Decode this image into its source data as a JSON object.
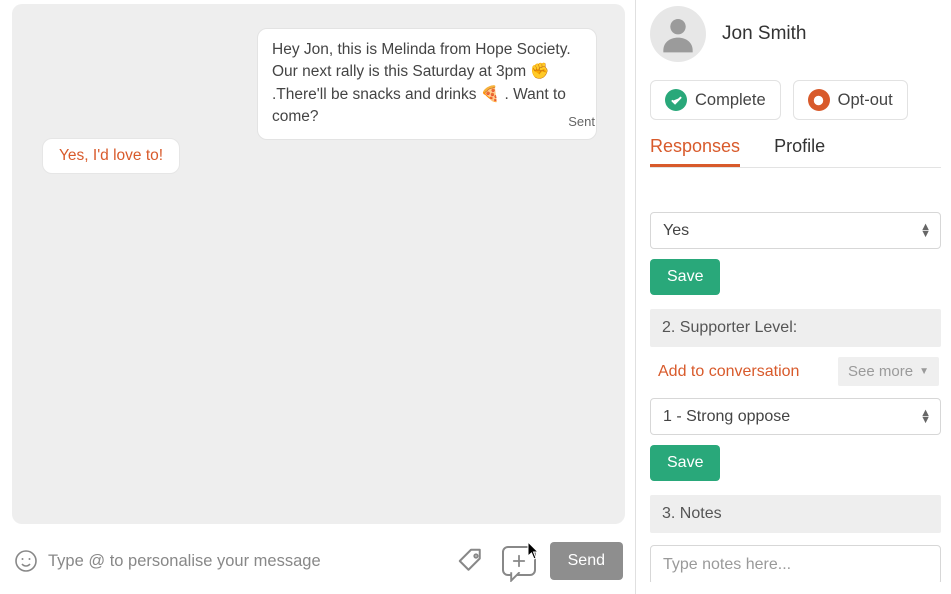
{
  "chat": {
    "outgoing": "Hey Jon, this is Melinda from Hope Society. Our next rally is this Saturday at 3pm ✊ .There'll be snacks and drinks 🍕 . Want to come?",
    "outgoing_status": "Sent",
    "incoming": "Yes, I'd love to!"
  },
  "composer": {
    "placeholder": "Type @ to personalise your message",
    "send_label": "Send"
  },
  "contact": {
    "name": "Jon  Smith"
  },
  "actions": {
    "complete": "Complete",
    "optout": "Opt-out"
  },
  "tabs": {
    "responses": "Responses",
    "profile": "Profile"
  },
  "questions": {
    "q1": {
      "selected": "Yes",
      "save": "Save"
    },
    "q2": {
      "header": "2. Supporter Level:",
      "add_link": "Add to conversation",
      "see_more": "See more",
      "selected": "1 - Strong oppose",
      "save": "Save"
    },
    "q3": {
      "header": "3. Notes",
      "placeholder": "Type notes here..."
    }
  }
}
